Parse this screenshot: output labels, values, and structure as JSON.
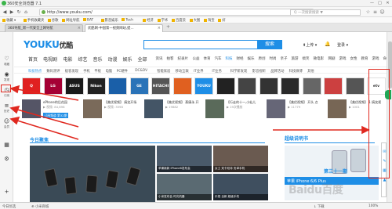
{
  "window": {
    "title": "360安全浏览器 7.1",
    "controls": [
      "—",
      "□",
      "✕"
    ]
  },
  "toolbar": {
    "url": "http://www.youku.com/",
    "badge": "优酷",
    "search_placeholder": "Q 一次搜索搜索 ▼",
    "zoom": "100%"
  },
  "bookmarks": [
    "收藏 ▾",
    "手机收藏夹",
    "谷歌",
    "网址导航",
    "BAT",
    "影音娱乐",
    "Tech",
    "经济",
    "学术",
    "百度云",
    "大图",
    "淘宝",
    "好"
  ],
  "tabs": [
    {
      "label": "360导航_新一代安全上网导航",
      "active": false
    },
    {
      "label": "优酷网-中国第一视频网站,提...",
      "active": true
    }
  ],
  "sidebar": [
    {
      "icon": "heart-icon",
      "glyph": "♡",
      "label": "收藏"
    },
    {
      "icon": "eye-icon",
      "glyph": "◉",
      "label": "发现"
    },
    {
      "icon": "clock-icon",
      "glyph": "◷",
      "label": "订阅"
    },
    {
      "icon": "menu-icon",
      "glyph": "≡",
      "label": "历史"
    },
    {
      "icon": "user-icon",
      "glyph": "☺",
      "label": "会员"
    }
  ],
  "page": {
    "logo_main": "YOUKU",
    "logo_cn": "优酷",
    "search_btn": "搜索",
    "upload": "⬆上传 ▾",
    "bell": "🔔",
    "login": "登录 ▾",
    "channels": [
      "首页",
      "电视剧",
      "电影",
      "综艺",
      "音乐",
      "动漫",
      "娱乐",
      "全部"
    ],
    "channels_small": [
      "资讯",
      "拍客",
      "纪录片",
      "公益",
      "体育",
      "汽车",
      "科技",
      "财经",
      "娱乐",
      "原创",
      "时尚",
      "亲子",
      "旅游",
      "搞笑",
      "微电影",
      "网剧",
      "游戏",
      "女性",
      "教育",
      "游戏",
      "命令",
      "APP下载"
    ],
    "channels_small_active": "科技",
    "subnav": [
      "科技热点",
      "数码测评",
      "极客发现",
      "手机",
      "平板",
      "电脑",
      "PC硬件",
      "DC&DV",
      "智能家居",
      "移动互联",
      "IT业界",
      "IT业务",
      "科学新发现",
      "影音视听",
      "品牌活动",
      "科技微博",
      "其他"
    ],
    "brands": [
      {
        "name": "Q",
        "color": "#e02020"
      },
      {
        "name": "LG",
        "color": "#a50034"
      },
      {
        "name": "ASUS",
        "color": "#1a1a1a"
      },
      {
        "name": "Nikon",
        "color": "#222222"
      },
      {
        "name": "",
        "color": "#1a5fa8"
      },
      {
        "name": "GE",
        "color": "#2a73b8"
      },
      {
        "name": "HITACHI",
        "color": "#555555"
      },
      {
        "name": "",
        "color": "#e06020"
      },
      {
        "name": "YOUKU",
        "color": "#1e8ee6"
      },
      {
        "name": "",
        "color": "#222222"
      },
      {
        "name": "",
        "color": "#444444"
      },
      {
        "name": "",
        "color": "#333333"
      },
      {
        "name": "",
        "color": "#2a2a2a"
      },
      {
        "name": "",
        "color": "#666666"
      },
      {
        "name": "",
        "color": "#cc4040"
      },
      {
        "name": "",
        "color": "#555555"
      },
      {
        "name": "etv",
        "color": "#ffffff"
      }
    ],
    "cards": [
      {
        "t1": "ePhone的后花园",
        "t2": "▶ 视频: 84,898",
        "t3": "",
        "btn": "订阅频道 第32期"
      },
      {
        "t1": "【美优视频】 搞笑开场",
        "t2": "▶ 视频: 3598",
        "t3": "",
        "btn": ""
      },
      {
        "t1": "【美优视频】 蔡康永 开",
        "t2": "▶ 19882",
        "t3": "",
        "btn": ""
      },
      {
        "t1": "【行走的十一,小仙儿",
        "t2": "▶ 19次播放",
        "t3": "",
        "btn": ""
      },
      {
        "t1": "【美优视频】 开头 点",
        "t2": "▶ 11779",
        "t3": "",
        "btn": ""
      },
      {
        "t1": "【美优视频】 1 搞笑视",
        "t2": "▶ 1001",
        "t3": "",
        "btn": ""
      }
    ],
    "section_today": "今日聚焦",
    "section_super": "超级说明书",
    "tiles": [
      {
        "cap": "苹果新款 iPhone6发布会"
      },
      {
        "cap": "女士 双卡双待 安卓手机"
      },
      {
        "cap": "小米发布会 时光机器"
      },
      {
        "cap": "乐视 全新 超级手机"
      },
      {
        "cap": "酷派 大神手机测评"
      }
    ],
    "right_ad": "苹果 iPhone 6/6 Plus",
    "right_ad_big": "第三十一期"
  },
  "status": {
    "left": "今日优选",
    "items": [
      "⊕ 小米商城",
      "↓ 下载",
      "100%"
    ],
    "zoom": "100%"
  },
  "watermark": "Baidu百度"
}
